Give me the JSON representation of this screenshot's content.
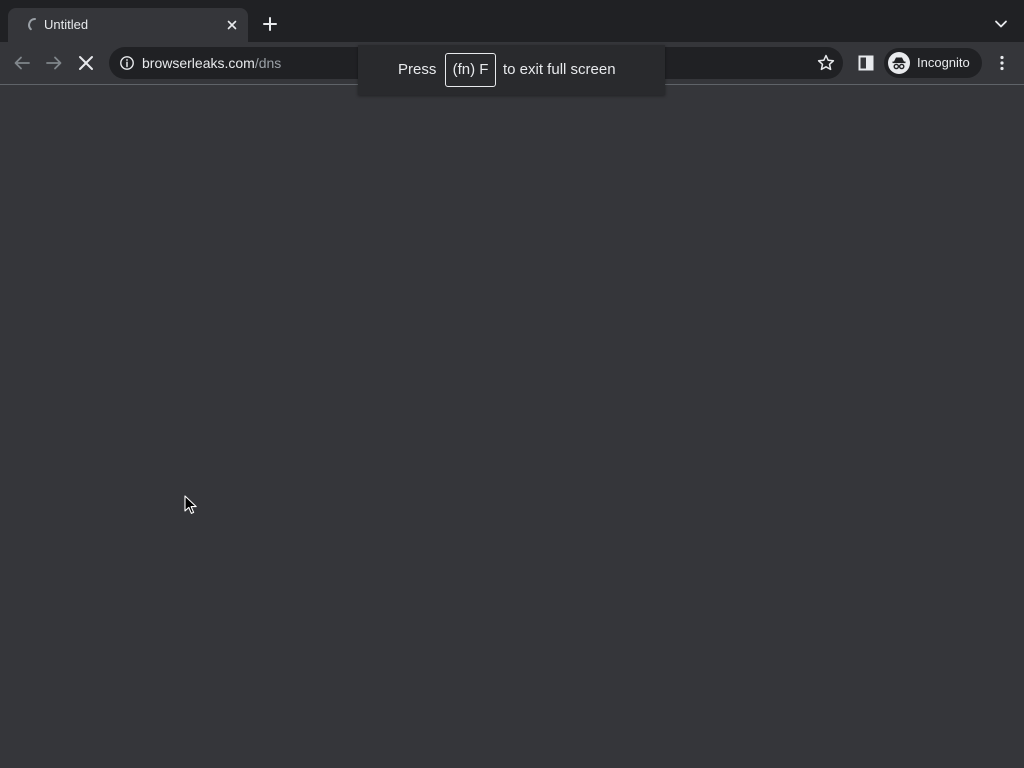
{
  "colors": {
    "tabstrip_bg": "#202124",
    "toolbar_bg": "#35363a",
    "content_bg": "#35363a",
    "text_primary": "#e8eaed",
    "text_secondary": "#9aa0a6"
  },
  "tabs": [
    {
      "title": "Untitled",
      "state": "loading",
      "icon": "loading-spinner-icon"
    }
  ],
  "tabstrip": {
    "new_tab_icon": "plus-icon",
    "tab_search_icon": "chevron-down-icon"
  },
  "toolbar": {
    "back_icon": "arrow-left-icon",
    "forward_icon": "arrow-right-icon",
    "stop_icon": "close-icon",
    "site_info_icon": "info-icon",
    "url_host": "browserleaks.com",
    "url_path": "/dns",
    "bookmark_icon": "star-outline-icon",
    "side_panel_icon": "side-panel-icon",
    "profile_label": "Incognito",
    "profile_icon": "incognito-icon",
    "menu_icon": "kebab-menu-icon"
  },
  "fullscreen_bubble": {
    "press": "Press",
    "key": "(fn) F",
    "message": "to exit full screen"
  }
}
